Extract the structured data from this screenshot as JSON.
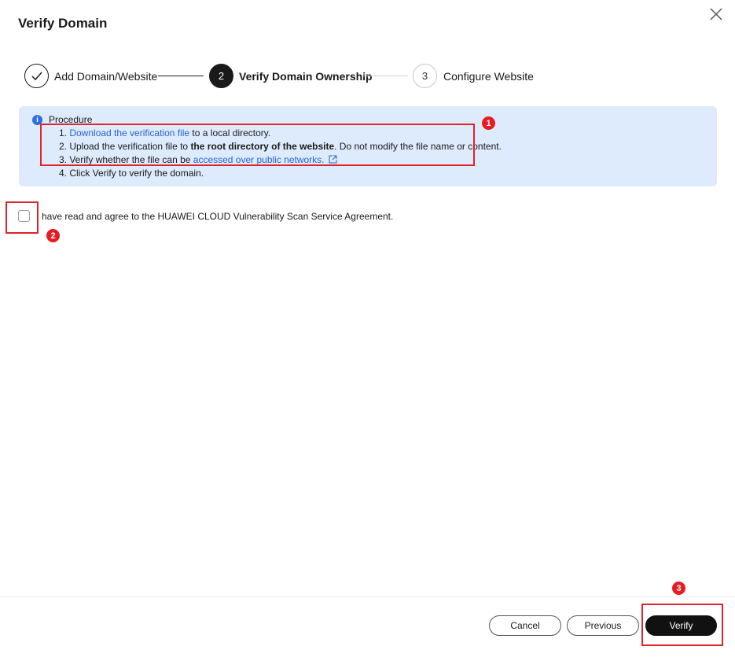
{
  "dialog": {
    "title": "Verify Domain",
    "close_icon": "close-icon"
  },
  "steps": [
    {
      "number": "",
      "label": "Add Domain/Website",
      "state": "done"
    },
    {
      "number": "2",
      "label": "Verify Domain Ownership",
      "state": "active"
    },
    {
      "number": "3",
      "label": "Configure Website",
      "state": "pending"
    }
  ],
  "procedure": {
    "icon": "info-icon",
    "icon_glyph": "i",
    "title": "Procedure",
    "line1": {
      "prefix": "1. ",
      "link": "Download the verification file",
      "suffix": " to a local directory."
    },
    "line2": {
      "prefix": "2. Upload the verification file to ",
      "bold": "the root directory of the website",
      "suffix": ". Do not modify the file name or content."
    },
    "line3": {
      "prefix": "3. Verify whether the file can be ",
      "link": "accessed over public networks.",
      "icon": "external-link-icon"
    },
    "line4": "4. Click Verify to verify the domain."
  },
  "agreement": {
    "checked": false,
    "text": "have read and agree to the HUAWEI CLOUD Vulnerability Scan Service Agreement."
  },
  "annotations": {
    "badge1": "1",
    "badge2": "2",
    "badge3": "3",
    "color": "#e81b23"
  },
  "footer": {
    "cancel": "Cancel",
    "previous": "Previous",
    "verify": "Verify"
  },
  "colors": {
    "accent": "#1a1a1a",
    "link": "#2664d6",
    "info_bg": "#deebfc",
    "info_icon": "#2b6fe0"
  }
}
